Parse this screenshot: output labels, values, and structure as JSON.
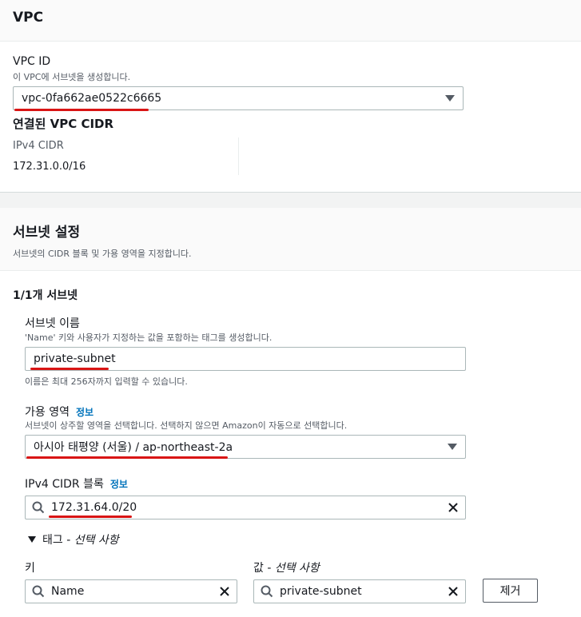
{
  "vpc_section": {
    "title": "VPC",
    "vpc_id_label": "VPC ID",
    "vpc_id_desc": "이 VPC에 서브넷을 생성합니다.",
    "vpc_id_value": "vpc-0fa662ae0522c6665",
    "cidr_heading": "연결된 VPC CIDR",
    "ipv4_cidr_label": "IPv4 CIDR",
    "ipv4_cidr_value": "172.31.0.0/16"
  },
  "subnet_settings": {
    "title": "서브넷 설정",
    "desc": "서브넷의 CIDR 블록 및 가용 영역을 지정합니다.",
    "counter": "1/1개 서브넷",
    "name_label": "서브넷 이름",
    "name_desc": "'Name' 키와 사용자가 지정하는 값을 포함하는 태그를 생성합니다.",
    "name_value": "private-subnet",
    "name_hint": "이름은 최대 256자까지 입력할 수 있습니다.",
    "az_label": "가용 영역",
    "az_info": "정보",
    "az_desc": "서브넷이 상주할 영역을 선택합니다. 선택하지 않으면 Amazon이 자동으로 선택합니다.",
    "az_value": "아시아 태평양 (서울) / ap-northeast-2a",
    "cidr_label": "IPv4 CIDR 블록",
    "cidr_info": "정보",
    "cidr_value": "172.31.64.0/20"
  },
  "tags": {
    "toggle_label": "태그 - ",
    "toggle_optional": "선택 사항",
    "key_label": "키",
    "value_label": "값 - ",
    "value_optional": "선택 사항",
    "key_value": "Name",
    "value_value": "private-subnet",
    "remove_label": "제거"
  },
  "colors": {
    "accent": "#0073bb",
    "annotation": "#d91515"
  }
}
